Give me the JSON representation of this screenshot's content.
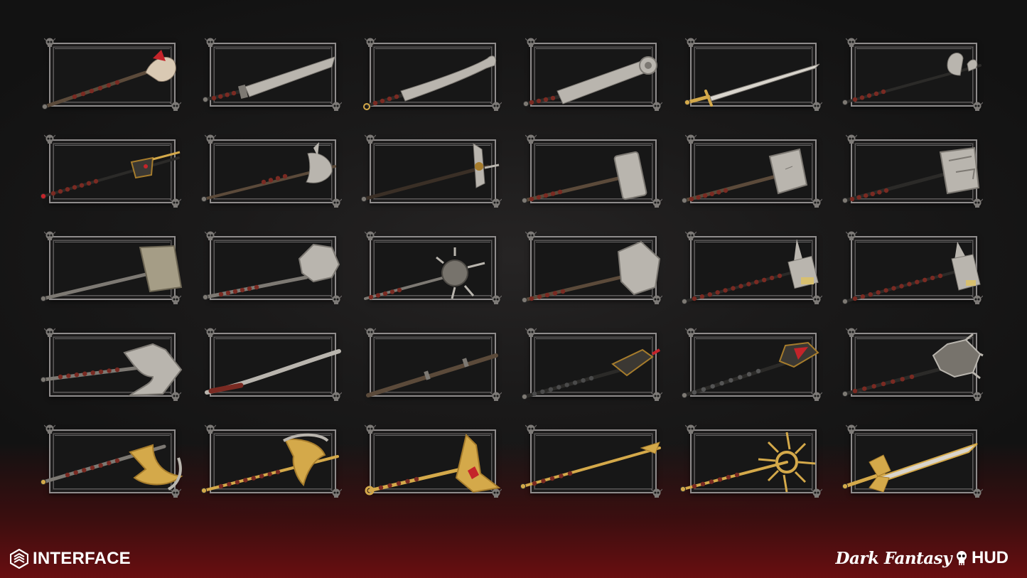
{
  "branding": {
    "left_label": "INTERFACE",
    "right_title_part1": "Dark Fantasy",
    "right_title_part2": "HUD"
  },
  "colors": {
    "background": "#141414",
    "frame_border": "#8f8c8c",
    "accent_red": "#c4242a",
    "gold": "#d4a94a"
  },
  "grid": {
    "rows": 5,
    "columns": 6
  },
  "weapons": [
    {
      "name": "bone-staff-icon"
    },
    {
      "name": "broadsword-icon"
    },
    {
      "name": "hooked-blade-icon"
    },
    {
      "name": "cleaver-sword-icon"
    },
    {
      "name": "longsword-icon"
    },
    {
      "name": "double-axe-polearm-icon"
    },
    {
      "name": "demon-spear-icon"
    },
    {
      "name": "halberd-icon"
    },
    {
      "name": "war-pick-icon"
    },
    {
      "name": "warhammer-icon"
    },
    {
      "name": "large-warhammer-icon"
    },
    {
      "name": "cracked-maul-icon"
    },
    {
      "name": "stone-maul-icon"
    },
    {
      "name": "round-mace-icon"
    },
    {
      "name": "morningstar-icon"
    },
    {
      "name": "heavy-mace-icon"
    },
    {
      "name": "spiked-hammer-icon"
    },
    {
      "name": "pointed-hammer-icon"
    },
    {
      "name": "hand-axe-icon"
    },
    {
      "name": "curved-staff-icon"
    },
    {
      "name": "wooden-staff-icon"
    },
    {
      "name": "flanged-mace-icon"
    },
    {
      "name": "gem-spear-icon"
    },
    {
      "name": "spiked-club-icon"
    },
    {
      "name": "golden-battle-axe-icon"
    },
    {
      "name": "golden-double-axe-icon"
    },
    {
      "name": "golden-scepter-icon"
    },
    {
      "name": "golden-spear-icon"
    },
    {
      "name": "sun-staff-icon"
    },
    {
      "name": "winged-sword-icon"
    }
  ]
}
